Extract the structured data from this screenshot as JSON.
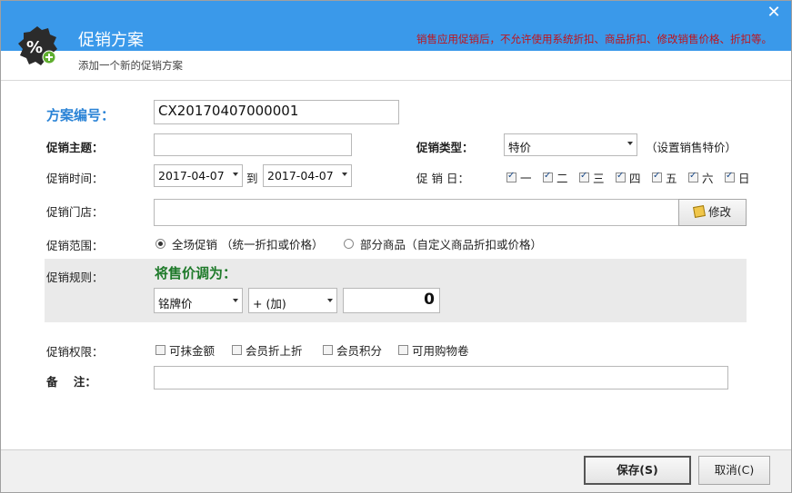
{
  "window": {
    "title": "促销方案",
    "subtitle": "添加一个新的促销方案",
    "notice": "销售应用促销后，不允许使用系统折扣、商品折扣、修改销售价格、折扣等。"
  },
  "colors": {
    "titlebar": "#3a99ea",
    "notice": "#c0131b",
    "plan_label": "#2a83d6",
    "rule_title": "#1e7a2a"
  },
  "form": {
    "plan_no_label": "方案编号：",
    "plan_no_value": "CX20170407000001",
    "theme_label": "促销主题：",
    "theme_value": "",
    "type_label": "促销类型：",
    "type_value": "特价",
    "type_hint": "（设置销售特价）",
    "time_label": "促销时间：",
    "date_from": "2017-04-07",
    "date_to_label": "到",
    "date_to": "2017-04-07",
    "day_label": "促 销 日：",
    "days": [
      "一",
      "二",
      "三",
      "四",
      "五",
      "六",
      "日"
    ],
    "store_label": "促销门店：",
    "store_value": "",
    "edit_button": "修改",
    "range_label": "促销范围：",
    "range_all": "全场促销 （统一折扣或价格）",
    "range_partial": "部分商品（自定义商品折扣或价格）",
    "rule_label": "促销规则：",
    "rule_title": "将售价调为：",
    "rule_price_type": "铭牌价",
    "rule_operator": "+ (加)",
    "rule_value": "0",
    "perm_label": "促销权限：",
    "permissions": [
      "可抹金额",
      "会员折上折",
      "会员积分",
      "可用购物卷"
    ],
    "note_label": "备    注：",
    "note_value": ""
  },
  "footer": {
    "save_label": "保存(S)",
    "cancel_label": "取消(C)"
  },
  "icons": {
    "logo": "percent-badge-icon",
    "close": "close-icon"
  }
}
